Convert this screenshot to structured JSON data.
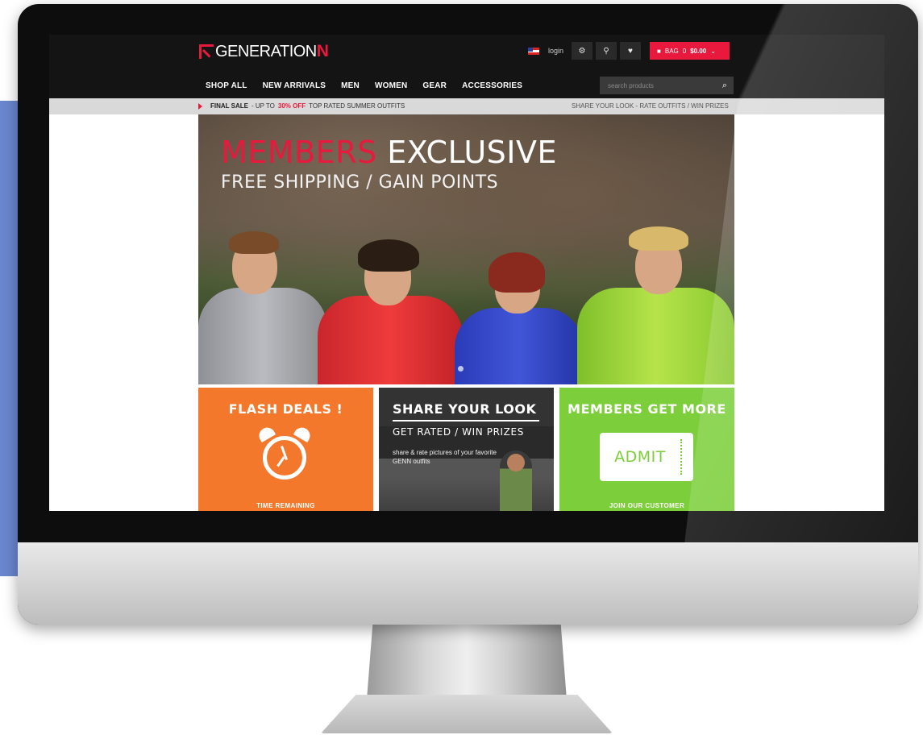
{
  "site": {
    "logo_main": "GENERATION",
    "logo_accent": "N"
  },
  "topbar": {
    "login": "login",
    "bag": "BAG",
    "bag_count": "0",
    "bag_total": "$0.00",
    "icons": [
      "flag-icon",
      "gear-icon",
      "location-pin-icon",
      "heart-icon",
      "bag-icon",
      "chevron-down-icon"
    ]
  },
  "nav": {
    "items": [
      "SHOP ALL",
      "NEW ARRIVALS",
      "MEN",
      "WOMEN",
      "GEAR",
      "ACCESSORIES"
    ]
  },
  "search": {
    "placeholder": "search products"
  },
  "promo": {
    "left_bold": "FINAL SALE",
    "left_mid": "- UP TO",
    "left_red": "30% OFF",
    "left_end": "TOP RATED SUMMER OUTFITS",
    "right": "SHARE YOUR LOOK - RATE OUTFITS / WIN PRIZES"
  },
  "hero": {
    "title_red": "MEMBERS",
    "title_white": "EXCLUSIVE",
    "subtitle": "FREE SHIPPING / GAIN POINTS"
  },
  "tiles": {
    "flash": {
      "title": "FLASH DEALS !",
      "time_label": "TIME REMAINING"
    },
    "share": {
      "title": "SHARE YOUR LOOK",
      "subtitle": "GET RATED / WIN PRIZES",
      "description": "share & rate pictures of your favorite GENN outfits"
    },
    "members": {
      "title": "MEMBERS GET MORE",
      "ticket": "ADMIT",
      "join": "JOIN OUR CUSTOMER"
    }
  },
  "colors": {
    "brand_red": "#e8193c",
    "flash_orange": "#f4782c",
    "members_green": "#7ccf3a",
    "header_dark": "#141414"
  }
}
